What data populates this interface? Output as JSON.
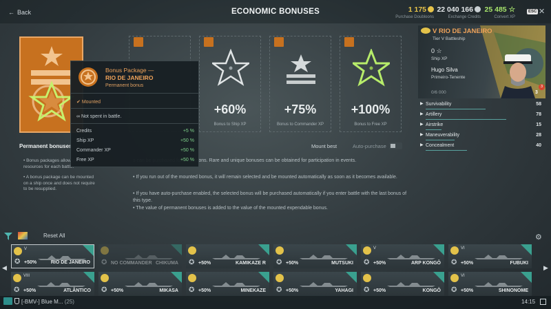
{
  "header": {
    "back_label": "Back",
    "title": "ECONOMIC BONUSES",
    "doubloons": {
      "value": "1 175",
      "label": "Purchase Doubloons",
      "color": "#e7c44a"
    },
    "credits": {
      "value": "22 040 166",
      "label": "Exchange Credits",
      "color": "#c9d0d3"
    },
    "free_xp": {
      "value": "25 485",
      "label": "Convert XP",
      "color": "#a6e36b"
    },
    "esc_label": "ESC"
  },
  "package": {
    "permanent_label": "Permanent bonuses",
    "bullets": [
      "Bonus packages allow you to save resources for each battle.",
      "A bonus package can be mounted on a ship once and does not require to be resupplied."
    ]
  },
  "slots": [
    {
      "value": "",
      "caption": ""
    },
    {
      "value": "+60%",
      "caption": "Bonus to Ship XP"
    },
    {
      "value": "+75%",
      "caption": "Bonus to Commander XP"
    },
    {
      "value": "+100%",
      "caption": "Bonus to Free XP"
    }
  ],
  "popup": {
    "title": "Bonus Package —",
    "title2": "RIO DE JANEIRO",
    "subtitle": "Permanent bonus",
    "mounted": "Mounted",
    "not_spent": "Not spent in battle.",
    "bonuses": [
      {
        "label": "Credits",
        "value": "+5 %"
      },
      {
        "label": "Ship XP",
        "value": "+50 %"
      },
      {
        "label": "Commander XP",
        "value": "+50 %"
      },
      {
        "label": "Free XP",
        "value": "+50 %"
      }
    ]
  },
  "controls": {
    "mount_best": "Mount best",
    "auto_purchase": "Auto-purchase"
  },
  "info": [
    "s can be purchased for Doubloons. Rare and unique bonuses can be obtained for participation in events.",
    "If you run out of the mounted bonus, it will remain selected and be mounted automatically as soon as it becomes available.",
    "If you have auto-purchase enabled, the selected bonus will be purchased automatically if you enter battle with the last bonus of this type.",
    "The value of permanent bonuses is added to the value of the mounted expendable bonus."
  ],
  "ship": {
    "name": "V RIO DE JANEIRO",
    "type": "Tier V Battleship",
    "xp": "0",
    "xp_label": "Ship XP",
    "commander": "Hugo Silva",
    "rank": "Primeiro-Tenente",
    "progress": "0/6 000",
    "skill_points": "3",
    "badge": "3"
  },
  "stats": [
    {
      "label": "Survivability",
      "value": "58",
      "fill": 0.58
    },
    {
      "label": "Artillery",
      "value": "78",
      "fill": 0.78
    },
    {
      "label": "Airstrike",
      "value": "15",
      "fill": 0.15
    },
    {
      "label": "Maneuverability",
      "value": "28",
      "fill": 0.28
    },
    {
      "label": "Concealment",
      "value": "40",
      "fill": 0.4
    }
  ],
  "filter": {
    "reset_all": "Reset All"
  },
  "carousel": [
    {
      "tier": "V",
      "pct": "+50%",
      "name": "RIO DE JANEIRO",
      "dim": false,
      "selected": true
    },
    {
      "tier": "",
      "pct": "NO COMMANDER",
      "name": "CHIKUMA",
      "dim": true,
      "selected": false
    },
    {
      "tier": "",
      "pct": "+50%",
      "name": "KAMIKAZE R",
      "dim": false,
      "selected": false
    },
    {
      "tier": "",
      "pct": "+50%",
      "name": "MUTSUKI",
      "dim": false,
      "selected": false
    },
    {
      "tier": "V",
      "pct": "+50%",
      "name": "ARP KONGŌ",
      "dim": false,
      "selected": false
    },
    {
      "tier": "VI",
      "pct": "+50%",
      "name": "FUBUKI",
      "dim": false,
      "selected": false
    },
    {
      "tier": "VIII",
      "pct": "+50%",
      "name": "ATLÂNTICO",
      "dim": false,
      "selected": false
    },
    {
      "tier": "",
      "pct": "+50%",
      "name": "MIKASA",
      "dim": false,
      "selected": false
    },
    {
      "tier": "",
      "pct": "+50%",
      "name": "MINEKAZE",
      "dim": false,
      "selected": false
    },
    {
      "tier": "",
      "pct": "+50%",
      "name": "YAHAGI",
      "dim": false,
      "selected": false
    },
    {
      "tier": "",
      "pct": "+50%",
      "name": "KONGŌ",
      "dim": false,
      "selected": false
    },
    {
      "tier": "VI",
      "pct": "+50%",
      "name": "SHINONOME",
      "dim": false,
      "selected": false
    }
  ],
  "bottom": {
    "clan": "[-BMV-] Blue M...",
    "clan_count": "(25)",
    "time": "14:15"
  }
}
